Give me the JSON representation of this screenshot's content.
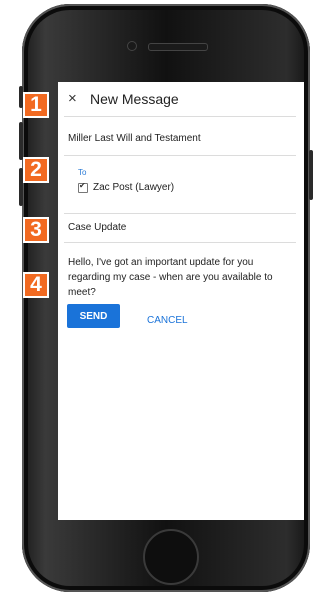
{
  "header": {
    "close_icon": "×",
    "title": "New Message"
  },
  "subject": "Miller Last Will and Testament",
  "recipients": {
    "label": "To",
    "items": [
      {
        "name": "Zac Post (Lawyer)",
        "checked": true
      }
    ]
  },
  "topic": "Case Update",
  "message_body": "Hello, I've got an important update for you regarding my case - when are you available to meet?",
  "actions": {
    "send_label": "SEND",
    "cancel_label": "CANCEL"
  },
  "steps": [
    "1",
    "2",
    "3",
    "4"
  ],
  "colors": {
    "accent": "#1a73d9",
    "badge": "#f26a21",
    "to_label": "#2a7bd6"
  }
}
